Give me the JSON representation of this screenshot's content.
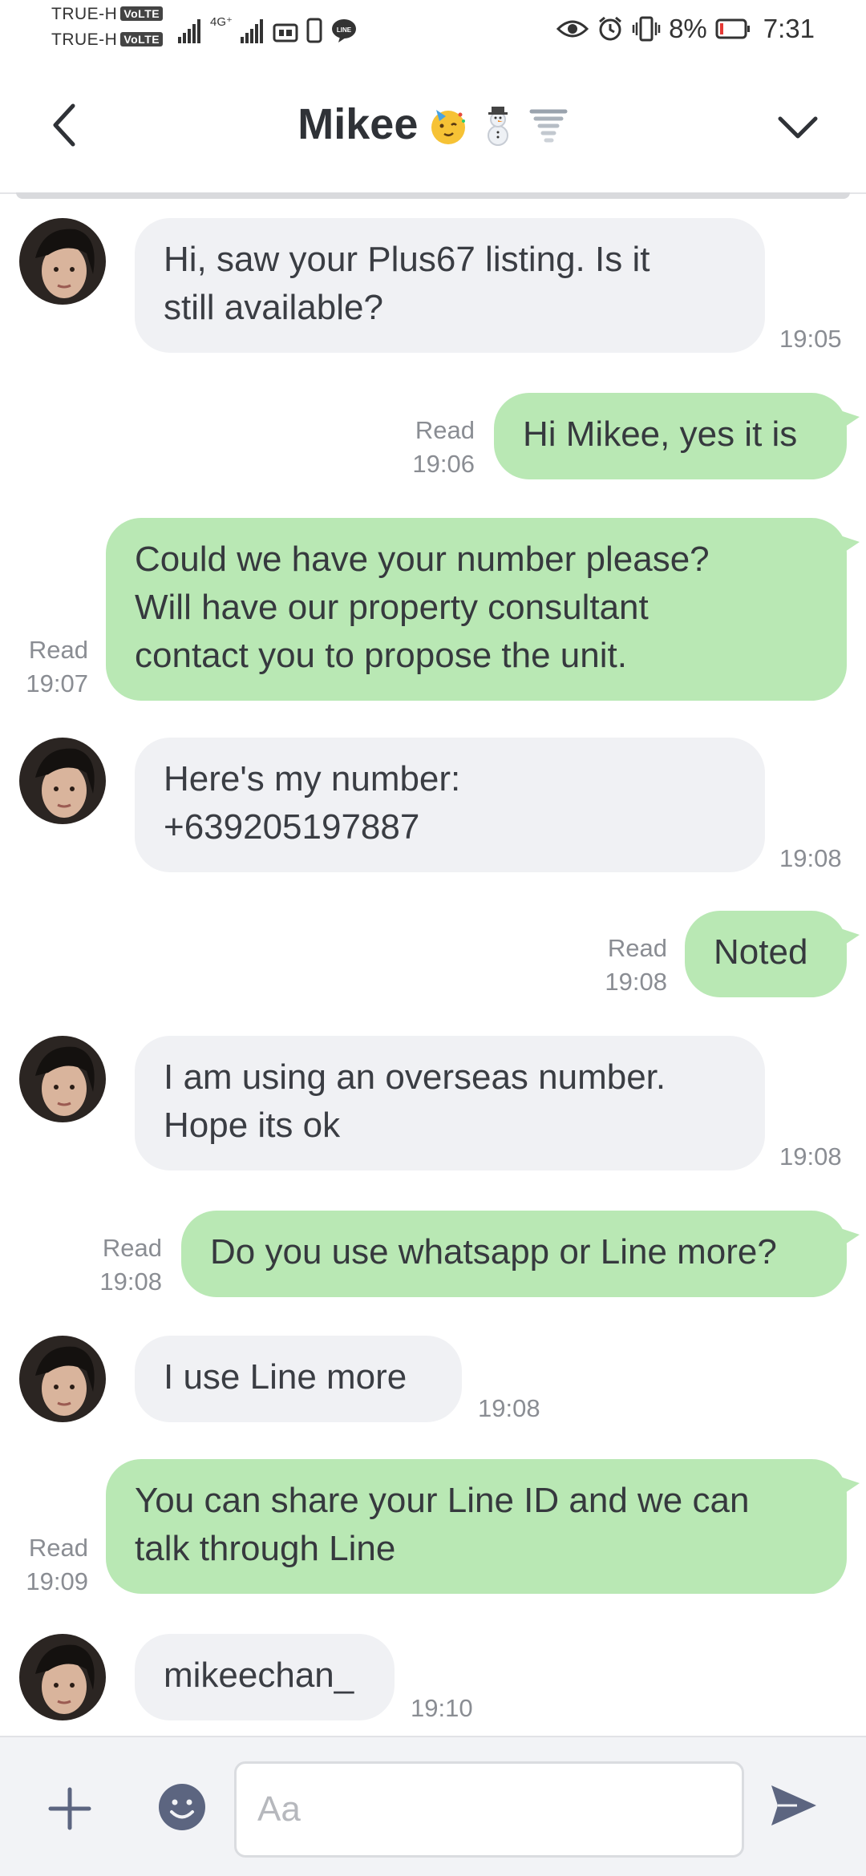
{
  "status_bar": {
    "carrier_1": "TRUE-H",
    "carrier_2": "TRUE-H",
    "volte": "VoLTE",
    "network": "4G⁺",
    "battery_pct": "8%",
    "time": "7:31",
    "battery_color": "#e53935"
  },
  "header": {
    "title": "Mikee",
    "emojis": [
      "party-face-emoji",
      "snowman-emoji",
      "tornado-emoji"
    ]
  },
  "messages": [
    {
      "side": "in",
      "lines": [
        "Hi, saw your Plus67 listing. Is it",
        "still available?"
      ],
      "time": "19:05"
    },
    {
      "side": "out",
      "lines": [
        "Hi Mikee, yes it is"
      ],
      "status": "Read",
      "time": "19:06"
    },
    {
      "side": "out",
      "lines": [
        "Could we have your number please?",
        "Will have our property consultant",
        "contact you to propose the unit."
      ],
      "status": "Read",
      "time": "19:07"
    },
    {
      "side": "in",
      "lines": [
        "Here's my number:",
        "+639205197887"
      ],
      "time": "19:08"
    },
    {
      "side": "out",
      "lines": [
        "Noted"
      ],
      "status": "Read",
      "time": "19:08"
    },
    {
      "side": "in",
      "lines": [
        "I am using an overseas number.",
        "Hope its ok"
      ],
      "time": "19:08"
    },
    {
      "side": "out",
      "lines": [
        "Do you use whatsapp or Line more?"
      ],
      "status": "Read",
      "time": "19:08"
    },
    {
      "side": "in",
      "lines": [
        "I use Line more"
      ],
      "time": "19:08"
    },
    {
      "side": "out",
      "lines": [
        "You can share your Line ID and we can",
        "talk through Line"
      ],
      "status": "Read",
      "time": "19:09"
    },
    {
      "side": "in",
      "lines": [
        "mikeechan_"
      ],
      "time": "19:10"
    }
  ],
  "input": {
    "placeholder": "Aa"
  },
  "colors": {
    "outgoing_bubble": "#b9e8b4",
    "incoming_bubble": "#f0f1f4",
    "icon": "#5c6580"
  }
}
